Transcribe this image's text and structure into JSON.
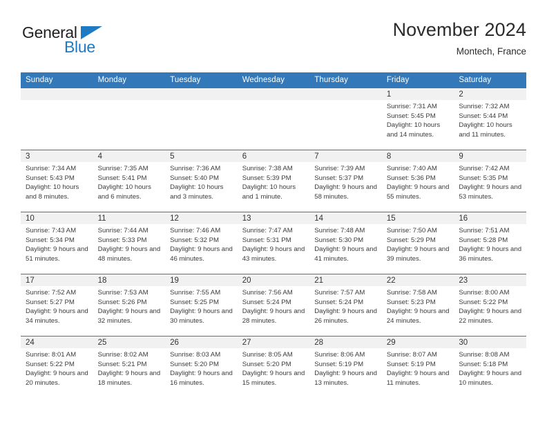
{
  "brand": {
    "line1": "General",
    "line2": "Blue",
    "accent_color": "#1f7ac4",
    "triangle_icon": "brand-triangle-icon"
  },
  "header": {
    "title": "November 2024",
    "subtitle": "Montech, France"
  },
  "theme": {
    "header_blue": "#3379b9",
    "daynum_band": "#f1f1f1",
    "text": "#3b3b3b"
  },
  "calendar": {
    "weekday_headers": [
      "Sunday",
      "Monday",
      "Tuesday",
      "Wednesday",
      "Thursday",
      "Friday",
      "Saturday"
    ],
    "labels": {
      "sunrise_prefix": "Sunrise: ",
      "sunset_prefix": "Sunset: ",
      "daylight_prefix": "Daylight: "
    },
    "weeks": [
      [
        {
          "day": "",
          "sunrise": "",
          "sunset": "",
          "daylight": ""
        },
        {
          "day": "",
          "sunrise": "",
          "sunset": "",
          "daylight": ""
        },
        {
          "day": "",
          "sunrise": "",
          "sunset": "",
          "daylight": ""
        },
        {
          "day": "",
          "sunrise": "",
          "sunset": "",
          "daylight": ""
        },
        {
          "day": "",
          "sunrise": "",
          "sunset": "",
          "daylight": ""
        },
        {
          "day": "1",
          "sunrise": "Sunrise: 7:31 AM",
          "sunset": "Sunset: 5:45 PM",
          "daylight": "Daylight: 10 hours and 14 minutes."
        },
        {
          "day": "2",
          "sunrise": "Sunrise: 7:32 AM",
          "sunset": "Sunset: 5:44 PM",
          "daylight": "Daylight: 10 hours and 11 minutes."
        }
      ],
      [
        {
          "day": "3",
          "sunrise": "Sunrise: 7:34 AM",
          "sunset": "Sunset: 5:43 PM",
          "daylight": "Daylight: 10 hours and 8 minutes."
        },
        {
          "day": "4",
          "sunrise": "Sunrise: 7:35 AM",
          "sunset": "Sunset: 5:41 PM",
          "daylight": "Daylight: 10 hours and 6 minutes."
        },
        {
          "day": "5",
          "sunrise": "Sunrise: 7:36 AM",
          "sunset": "Sunset: 5:40 PM",
          "daylight": "Daylight: 10 hours and 3 minutes."
        },
        {
          "day": "6",
          "sunrise": "Sunrise: 7:38 AM",
          "sunset": "Sunset: 5:39 PM",
          "daylight": "Daylight: 10 hours and 1 minute."
        },
        {
          "day": "7",
          "sunrise": "Sunrise: 7:39 AM",
          "sunset": "Sunset: 5:37 PM",
          "daylight": "Daylight: 9 hours and 58 minutes."
        },
        {
          "day": "8",
          "sunrise": "Sunrise: 7:40 AM",
          "sunset": "Sunset: 5:36 PM",
          "daylight": "Daylight: 9 hours and 55 minutes."
        },
        {
          "day": "9",
          "sunrise": "Sunrise: 7:42 AM",
          "sunset": "Sunset: 5:35 PM",
          "daylight": "Daylight: 9 hours and 53 minutes."
        }
      ],
      [
        {
          "day": "10",
          "sunrise": "Sunrise: 7:43 AM",
          "sunset": "Sunset: 5:34 PM",
          "daylight": "Daylight: 9 hours and 51 minutes."
        },
        {
          "day": "11",
          "sunrise": "Sunrise: 7:44 AM",
          "sunset": "Sunset: 5:33 PM",
          "daylight": "Daylight: 9 hours and 48 minutes."
        },
        {
          "day": "12",
          "sunrise": "Sunrise: 7:46 AM",
          "sunset": "Sunset: 5:32 PM",
          "daylight": "Daylight: 9 hours and 46 minutes."
        },
        {
          "day": "13",
          "sunrise": "Sunrise: 7:47 AM",
          "sunset": "Sunset: 5:31 PM",
          "daylight": "Daylight: 9 hours and 43 minutes."
        },
        {
          "day": "14",
          "sunrise": "Sunrise: 7:48 AM",
          "sunset": "Sunset: 5:30 PM",
          "daylight": "Daylight: 9 hours and 41 minutes."
        },
        {
          "day": "15",
          "sunrise": "Sunrise: 7:50 AM",
          "sunset": "Sunset: 5:29 PM",
          "daylight": "Daylight: 9 hours and 39 minutes."
        },
        {
          "day": "16",
          "sunrise": "Sunrise: 7:51 AM",
          "sunset": "Sunset: 5:28 PM",
          "daylight": "Daylight: 9 hours and 36 minutes."
        }
      ],
      [
        {
          "day": "17",
          "sunrise": "Sunrise: 7:52 AM",
          "sunset": "Sunset: 5:27 PM",
          "daylight": "Daylight: 9 hours and 34 minutes."
        },
        {
          "day": "18",
          "sunrise": "Sunrise: 7:53 AM",
          "sunset": "Sunset: 5:26 PM",
          "daylight": "Daylight: 9 hours and 32 minutes."
        },
        {
          "day": "19",
          "sunrise": "Sunrise: 7:55 AM",
          "sunset": "Sunset: 5:25 PM",
          "daylight": "Daylight: 9 hours and 30 minutes."
        },
        {
          "day": "20",
          "sunrise": "Sunrise: 7:56 AM",
          "sunset": "Sunset: 5:24 PM",
          "daylight": "Daylight: 9 hours and 28 minutes."
        },
        {
          "day": "21",
          "sunrise": "Sunrise: 7:57 AM",
          "sunset": "Sunset: 5:24 PM",
          "daylight": "Daylight: 9 hours and 26 minutes."
        },
        {
          "day": "22",
          "sunrise": "Sunrise: 7:58 AM",
          "sunset": "Sunset: 5:23 PM",
          "daylight": "Daylight: 9 hours and 24 minutes."
        },
        {
          "day": "23",
          "sunrise": "Sunrise: 8:00 AM",
          "sunset": "Sunset: 5:22 PM",
          "daylight": "Daylight: 9 hours and 22 minutes."
        }
      ],
      [
        {
          "day": "24",
          "sunrise": "Sunrise: 8:01 AM",
          "sunset": "Sunset: 5:22 PM",
          "daylight": "Daylight: 9 hours and 20 minutes."
        },
        {
          "day": "25",
          "sunrise": "Sunrise: 8:02 AM",
          "sunset": "Sunset: 5:21 PM",
          "daylight": "Daylight: 9 hours and 18 minutes."
        },
        {
          "day": "26",
          "sunrise": "Sunrise: 8:03 AM",
          "sunset": "Sunset: 5:20 PM",
          "daylight": "Daylight: 9 hours and 16 minutes."
        },
        {
          "day": "27",
          "sunrise": "Sunrise: 8:05 AM",
          "sunset": "Sunset: 5:20 PM",
          "daylight": "Daylight: 9 hours and 15 minutes."
        },
        {
          "day": "28",
          "sunrise": "Sunrise: 8:06 AM",
          "sunset": "Sunset: 5:19 PM",
          "daylight": "Daylight: 9 hours and 13 minutes."
        },
        {
          "day": "29",
          "sunrise": "Sunrise: 8:07 AM",
          "sunset": "Sunset: 5:19 PM",
          "daylight": "Daylight: 9 hours and 11 minutes."
        },
        {
          "day": "30",
          "sunrise": "Sunrise: 8:08 AM",
          "sunset": "Sunset: 5:18 PM",
          "daylight": "Daylight: 9 hours and 10 minutes."
        }
      ]
    ]
  }
}
